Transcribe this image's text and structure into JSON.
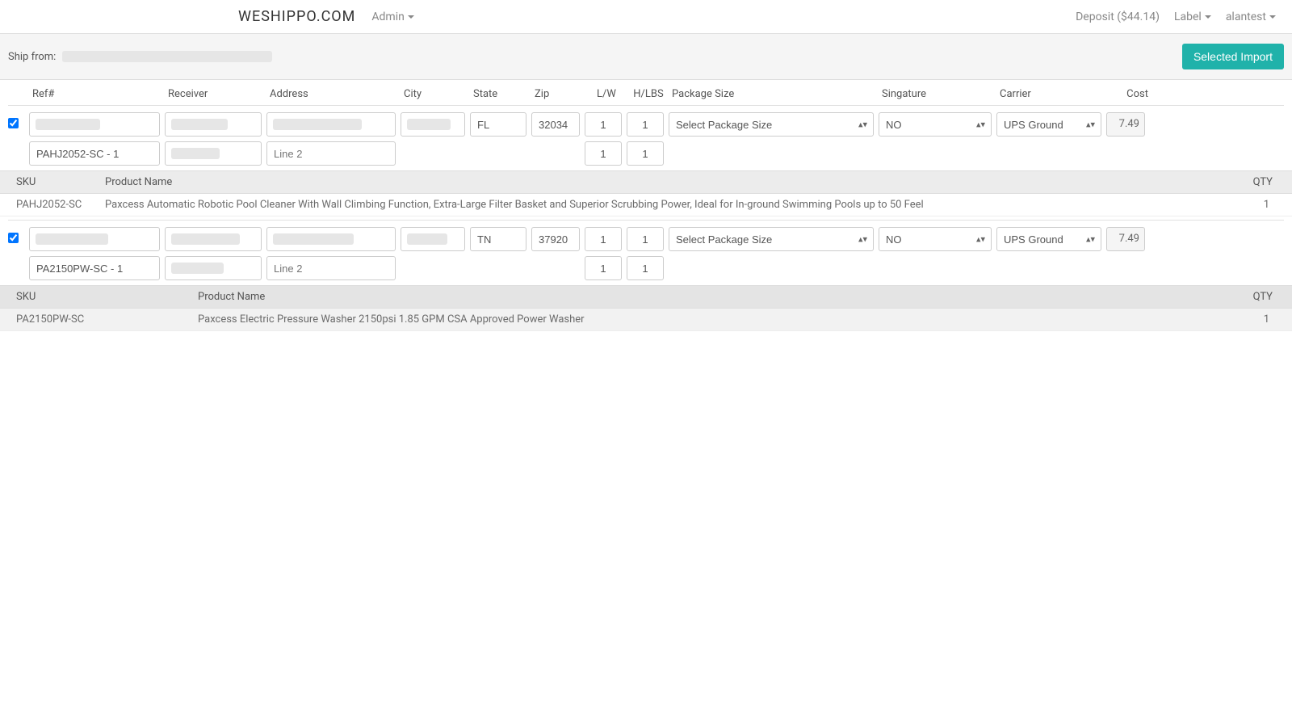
{
  "navbar": {
    "brand": "WESHIPPO.COM",
    "admin": "Admin",
    "deposit": "Deposit ($44.14)",
    "label": "Label",
    "user": "alantest"
  },
  "shipbar": {
    "label": "Ship from:",
    "button": "Selected Import"
  },
  "headers": {
    "ref": "Ref#",
    "receiver": "Receiver",
    "address": "Address",
    "city": "City",
    "state": "State",
    "zip": "Zip",
    "lw": "L/W",
    "hlbs": "H/LBS",
    "pkg": "Package Size",
    "sig": "Singature",
    "carrier": "Carrier",
    "cost": "Cost"
  },
  "orders": [
    {
      "checked": true,
      "ref2": "PAHJ2052-SC - 1",
      "addr2_placeholder": "Line 2",
      "state": "FL",
      "zip": "32034",
      "l": "1",
      "w": "1",
      "h": "1",
      "lbs": "1",
      "pkg": "Select Package Size",
      "sig": "NO",
      "carrier": "UPS Ground",
      "cost": "7.49",
      "items_header": {
        "sku": "SKU",
        "name": "Product Name",
        "qty": "QTY"
      },
      "items": [
        {
          "sku": "PAHJ2052-SC",
          "name": "Paxcess Automatic Robotic Pool Cleaner With Wall Climbing Function, Extra-Large Filter Basket and Superior Scrubbing Power, Ideal for In-ground Swimming Pools up to 50 Feel",
          "qty": "1"
        }
      ]
    },
    {
      "checked": true,
      "ref2": "PA2150PW-SC - 1",
      "addr2_placeholder": "Line 2",
      "state": "TN",
      "zip": "37920",
      "l": "1",
      "w": "1",
      "h": "1",
      "lbs": "1",
      "pkg": "Select Package Size",
      "sig": "NO",
      "carrier": "UPS Ground",
      "cost": "7.49",
      "items_header": {
        "sku": "SKU",
        "name": "Product Name",
        "qty": "QTY"
      },
      "items": [
        {
          "sku": "PA2150PW-SC",
          "name": "Paxcess Electric Pressure Washer 2150psi 1.85 GPM CSA Approved Power Washer",
          "qty": "1"
        }
      ]
    }
  ]
}
